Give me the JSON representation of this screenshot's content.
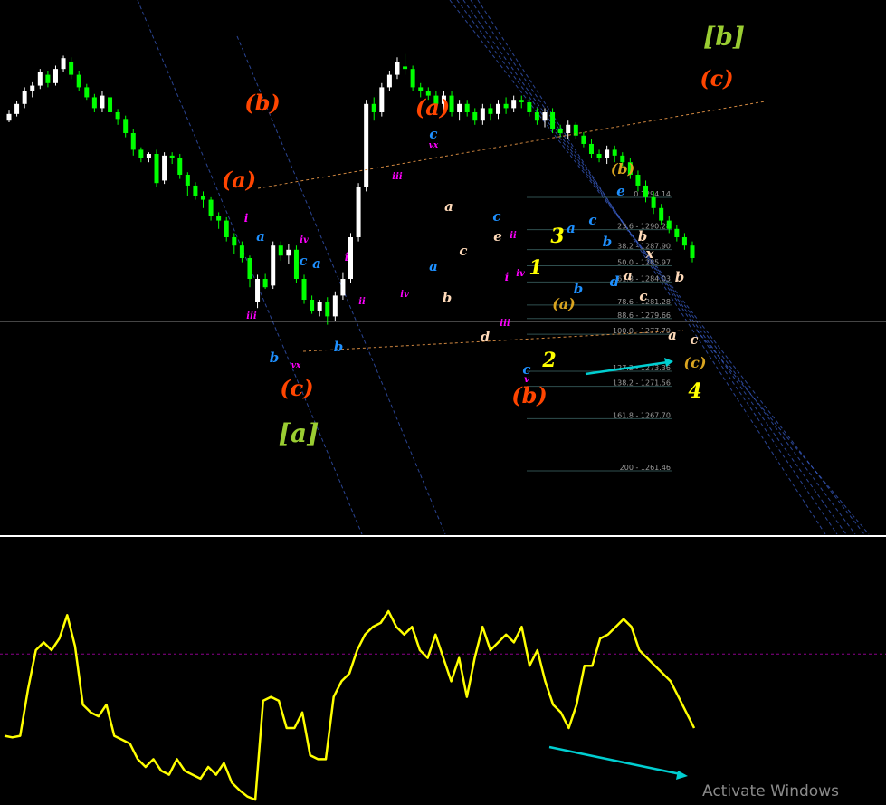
{
  "chart_data": [
    {
      "type": "candlestick",
      "panel": "price",
      "fib_levels": [
        {
          "label": "0",
          "price": 1294.14
        },
        {
          "label": "23.6",
          "price": 1290.28
        },
        {
          "label": "38.2",
          "price": 1287.9
        },
        {
          "label": "50.0",
          "price": 1285.97
        },
        {
          "label": "61.8",
          "price": 1284.03
        },
        {
          "label": "78.6",
          "price": 1281.28
        },
        {
          "label": "88.6",
          "price": 1279.66
        },
        {
          "label": "100.0",
          "price": 1277.79
        },
        {
          "label": "127.2",
          "price": 1273.36
        },
        {
          "label": "138.2",
          "price": 1271.56
        },
        {
          "label": "161.8",
          "price": 1267.7
        },
        {
          "label": "200",
          "price": 1261.46
        }
      ],
      "fib_text": [
        "0 1294.14",
        "23.6 - 1290.28",
        "38.2 - 1287.90",
        "50.0 - 1285.97",
        "61.8 - 1284.03",
        "78.6 - 1281.28",
        "88.6 - 1279.66",
        "100.0 - 1277.79",
        "127.2 - 1273.36",
        "138.2 - 1271.56",
        "161.8 - 1267.70",
        "200 - 1261.46"
      ],
      "wave_labels": [
        {
          "text": "[b]",
          "color": "#9ACD32"
        },
        {
          "text": "(c)",
          "color": "#FF4500"
        },
        {
          "text": "(b)",
          "color": "#FF4500"
        },
        {
          "text": "(a)",
          "color": "#FF4500"
        },
        {
          "text": "(a)",
          "color": "#FF4500"
        },
        {
          "text": "(c)",
          "color": "#FF4500"
        },
        {
          "text": "[a]",
          "color": "#9ACD32"
        },
        {
          "text": "(b)",
          "color": "#FF4500"
        },
        {
          "text": "(b)",
          "color": "#DAA520"
        },
        {
          "text": "(a)",
          "color": "#DAA520"
        },
        {
          "text": "(c)",
          "color": "#DAA520"
        },
        {
          "text": "1",
          "color": "#FFFF00"
        },
        {
          "text": "2",
          "color": "#FFFF00"
        },
        {
          "text": "3",
          "color": "#FFFF00"
        },
        {
          "text": "4",
          "color": "#FFFF00"
        },
        {
          "text": "a",
          "color": "#1E90FF"
        },
        {
          "text": "b",
          "color": "#1E90FF"
        },
        {
          "text": "c",
          "color": "#1E90FF"
        },
        {
          "text": "a",
          "color": "#1E90FF"
        },
        {
          "text": "c",
          "color": "#1E90FF"
        },
        {
          "text": "b",
          "color": "#1E90FF"
        },
        {
          "text": "c",
          "color": "#1E90FF"
        },
        {
          "text": "a",
          "color": "#1E90FF"
        },
        {
          "text": "b",
          "color": "#1E90FF"
        },
        {
          "text": "c",
          "color": "#1E90FF"
        },
        {
          "text": "a",
          "color": "#1E90FF"
        },
        {
          "text": "c",
          "color": "#1E90FF"
        },
        {
          "text": "b",
          "color": "#1E90FF"
        },
        {
          "text": "d",
          "color": "#1E90FF"
        },
        {
          "text": "e",
          "color": "#1E90FF"
        },
        {
          "text": "a",
          "color": "#FFDAB9"
        },
        {
          "text": "b",
          "color": "#FFDAB9"
        },
        {
          "text": "c",
          "color": "#FFDAB9"
        },
        {
          "text": "d",
          "color": "#FFDAB9"
        },
        {
          "text": "e",
          "color": "#FFDAB9"
        },
        {
          "text": "b",
          "color": "#FFDAB9"
        },
        {
          "text": "x",
          "color": "#FFDAB9"
        },
        {
          "text": "a",
          "color": "#FFDAB9"
        },
        {
          "text": "c",
          "color": "#FFDAB9"
        },
        {
          "text": "b",
          "color": "#FFDAB9"
        },
        {
          "text": "a",
          "color": "#FFDAB9"
        },
        {
          "text": "c",
          "color": "#FFDAB9"
        },
        {
          "text": "i",
          "color": "#FF00FF"
        },
        {
          "text": "iii",
          "color": "#FF00FF"
        },
        {
          "text": "iv",
          "color": "#FF00FF"
        },
        {
          "text": "vx",
          "color": "#FF00FF"
        },
        {
          "text": "i",
          "color": "#FF00FF"
        },
        {
          "text": "ii",
          "color": "#FF00FF"
        },
        {
          "text": "iii",
          "color": "#FF00FF"
        },
        {
          "text": "iv",
          "color": "#FF00FF"
        },
        {
          "text": "vx",
          "color": "#FF00FF"
        },
        {
          "text": "ii",
          "color": "#FF00FF"
        },
        {
          "text": "i",
          "color": "#FF00FF"
        },
        {
          "text": "iii",
          "color": "#FF00FF"
        },
        {
          "text": "iv",
          "color": "#FF00FF"
        },
        {
          "text": "v",
          "color": "#FF00FF"
        }
      ],
      "candles": [
        [
          0,
          290,
          298,
          288,
          302
        ],
        [
          1,
          298,
          310,
          295,
          314
        ],
        [
          2,
          310,
          325,
          305,
          330
        ],
        [
          3,
          325,
          332,
          318,
          336
        ],
        [
          4,
          332,
          348,
          328,
          352
        ],
        [
          5,
          345,
          335,
          330,
          350
        ],
        [
          6,
          335,
          352,
          332,
          356
        ],
        [
          7,
          352,
          365,
          348,
          368
        ],
        [
          8,
          360,
          345,
          340,
          366
        ],
        [
          9,
          345,
          330,
          326,
          350
        ],
        [
          10,
          330,
          318,
          315,
          334
        ],
        [
          11,
          318,
          305,
          300,
          322
        ],
        [
          12,
          305,
          320,
          300,
          325
        ],
        [
          13,
          318,
          300,
          296,
          322
        ],
        [
          14,
          300,
          292,
          285,
          304
        ],
        [
          15,
          292,
          275,
          270,
          296
        ],
        [
          16,
          275,
          255,
          248,
          280
        ],
        [
          17,
          255,
          245,
          240,
          258
        ],
        [
          18,
          245,
          250,
          240,
          252
        ],
        [
          19,
          250,
          215,
          210,
          255
        ],
        [
          20,
          218,
          248,
          214,
          252
        ],
        [
          21,
          248,
          245,
          238,
          252
        ],
        [
          22,
          245,
          225,
          220,
          250
        ],
        [
          23,
          225,
          212,
          200,
          228
        ],
        [
          24,
          212,
          200,
          195,
          216
        ],
        [
          25,
          200,
          195,
          185,
          205
        ],
        [
          26,
          195,
          175,
          170,
          198
        ],
        [
          27,
          175,
          170,
          160,
          180
        ],
        [
          28,
          170,
          150,
          145,
          174
        ],
        [
          29,
          150,
          140,
          130,
          155
        ],
        [
          30,
          140,
          125,
          120,
          145
        ],
        [
          31,
          125,
          100,
          90,
          128
        ],
        [
          32,
          72,
          100,
          65,
          105
        ],
        [
          33,
          100,
          90,
          88,
          106
        ],
        [
          34,
          92,
          140,
          88,
          145
        ],
        [
          35,
          140,
          128,
          122,
          145
        ],
        [
          36,
          128,
          135,
          118,
          142
        ],
        [
          37,
          135,
          100,
          95,
          140
        ],
        [
          38,
          100,
          75,
          70,
          105
        ],
        [
          39,
          75,
          62,
          58,
          80
        ],
        [
          40,
          62,
          72,
          55,
          75
        ],
        [
          41,
          72,
          55,
          45,
          78
        ],
        [
          42,
          55,
          80,
          50,
          85
        ],
        [
          43,
          80,
          100,
          75,
          108
        ],
        [
          44,
          100,
          150,
          95,
          155
        ],
        [
          45,
          150,
          210,
          145,
          215
        ],
        [
          46,
          210,
          310,
          205,
          315
        ],
        [
          47,
          310,
          300,
          290,
          318
        ],
        [
          48,
          300,
          330,
          295,
          335
        ],
        [
          49,
          330,
          345,
          325,
          350
        ],
        [
          50,
          345,
          360,
          340,
          366
        ],
        [
          51,
          355,
          352,
          345,
          370
        ],
        [
          52,
          352,
          330,
          325,
          356
        ],
        [
          53,
          330,
          325,
          318,
          335
        ],
        [
          54,
          325,
          320,
          315,
          330
        ],
        [
          55,
          320,
          310,
          305,
          325
        ],
        [
          56,
          310,
          320,
          300,
          325
        ],
        [
          57,
          320,
          300,
          295,
          325
        ],
        [
          58,
          300,
          310,
          290,
          315
        ],
        [
          59,
          310,
          300,
          295,
          315
        ],
        [
          60,
          300,
          290,
          285,
          305
        ],
        [
          61,
          290,
          305,
          285,
          310
        ],
        [
          62,
          305,
          298,
          290,
          310
        ],
        [
          63,
          298,
          310,
          292,
          315
        ],
        [
          64,
          310,
          305,
          298,
          318
        ],
        [
          65,
          305,
          315,
          300,
          320
        ],
        [
          66,
          315,
          312,
          305,
          320
        ],
        [
          67,
          312,
          300,
          295,
          316
        ],
        [
          68,
          300,
          290,
          285,
          305
        ],
        [
          69,
          290,
          300,
          282,
          305
        ],
        [
          70,
          300,
          280,
          275,
          305
        ],
        [
          71,
          280,
          275,
          270,
          285
        ],
        [
          72,
          275,
          285,
          268,
          290
        ],
        [
          73,
          285,
          272,
          268,
          288
        ],
        [
          74,
          272,
          262,
          258,
          276
        ],
        [
          75,
          262,
          250,
          245,
          268
        ],
        [
          76,
          250,
          245,
          240,
          255
        ],
        [
          77,
          245,
          255,
          238,
          260
        ],
        [
          78,
          255,
          248,
          240,
          260
        ],
        [
          79,
          248,
          240,
          235,
          252
        ],
        [
          80,
          240,
          225,
          220,
          245
        ],
        [
          81,
          225,
          212,
          205,
          230
        ],
        [
          82,
          212,
          198,
          192,
          218
        ],
        [
          83,
          198,
          185,
          178,
          205
        ],
        [
          84,
          185,
          170,
          165,
          190
        ],
        [
          85,
          170,
          160,
          155,
          175
        ],
        [
          86,
          160,
          150,
          145,
          165
        ],
        [
          87,
          150,
          140,
          135,
          155
        ],
        [
          88,
          140,
          125,
          120,
          145
        ]
      ]
    },
    {
      "type": "line",
      "panel": "oscillator",
      "series": [
        {
          "color": "#FFFF00",
          "values": [
            690,
            688,
            690,
            750,
            800,
            810,
            800,
            815,
            845,
            805,
            730,
            720,
            715,
            730,
            690,
            685,
            680,
            660,
            650,
            660,
            645,
            640,
            660,
            645,
            640,
            635,
            650,
            640,
            655,
            630,
            620,
            612,
            608,
            735,
            740,
            735,
            700,
            700,
            720,
            665,
            660,
            660,
            740,
            760,
            770,
            800,
            820,
            830,
            835,
            850,
            830,
            820,
            830,
            800,
            790,
            820,
            790,
            760,
            790,
            740,
            790,
            830,
            800,
            810,
            820,
            810,
            830,
            780,
            800,
            760,
            730,
            720,
            700,
            730,
            780,
            780,
            815,
            820,
            830,
            840,
            830,
            800,
            790,
            780,
            770,
            760,
            740,
            720,
            700
          ]
        }
      ],
      "hlines": [
        {
          "value": 795,
          "color": "#8B008B",
          "style": "dashed"
        }
      ]
    }
  ],
  "watermark": "Activate Windows",
  "colors": {
    "background": "#000000",
    "candle_bull": "#FFFFFF",
    "candle_bear": "#00FF00",
    "oscillator_line": "#FFFF00",
    "divergence_arrow": "#00CED1",
    "channel": "#4169E1",
    "fib_line": "#2F4F4F"
  }
}
